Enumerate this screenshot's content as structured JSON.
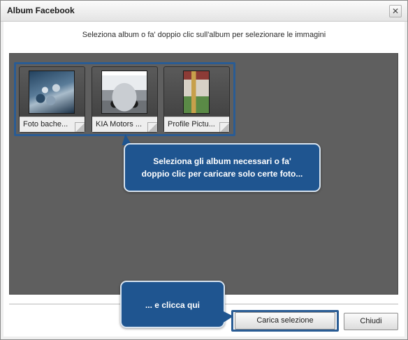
{
  "window": {
    "title": "Album Facebook",
    "close_glyph": "✕"
  },
  "instruction": "Seleziona album o fa' doppio clic sull'album per selezionare le immagini",
  "albums": [
    {
      "label": "Foto bache...",
      "thumb_icon": "leopard-photo"
    },
    {
      "label": "KIA Motors ...",
      "thumb_icon": "car-photo"
    },
    {
      "label": "Profile Pictu...",
      "thumb_icon": "profile-photo"
    }
  ],
  "tooltips": {
    "select_hint_line1": "Seleziona gli album necessari o fa'",
    "select_hint_line2": "doppio clic per caricare solo certe foto...",
    "click_hint": "... e clicca qui"
  },
  "buttons": {
    "load_selection": "Carica selezione",
    "close": "Chiudi"
  },
  "colors": {
    "accent_blue": "#1f5590",
    "highlight_border": "#2a5c94",
    "panel_gray": "#5f5f5f"
  }
}
